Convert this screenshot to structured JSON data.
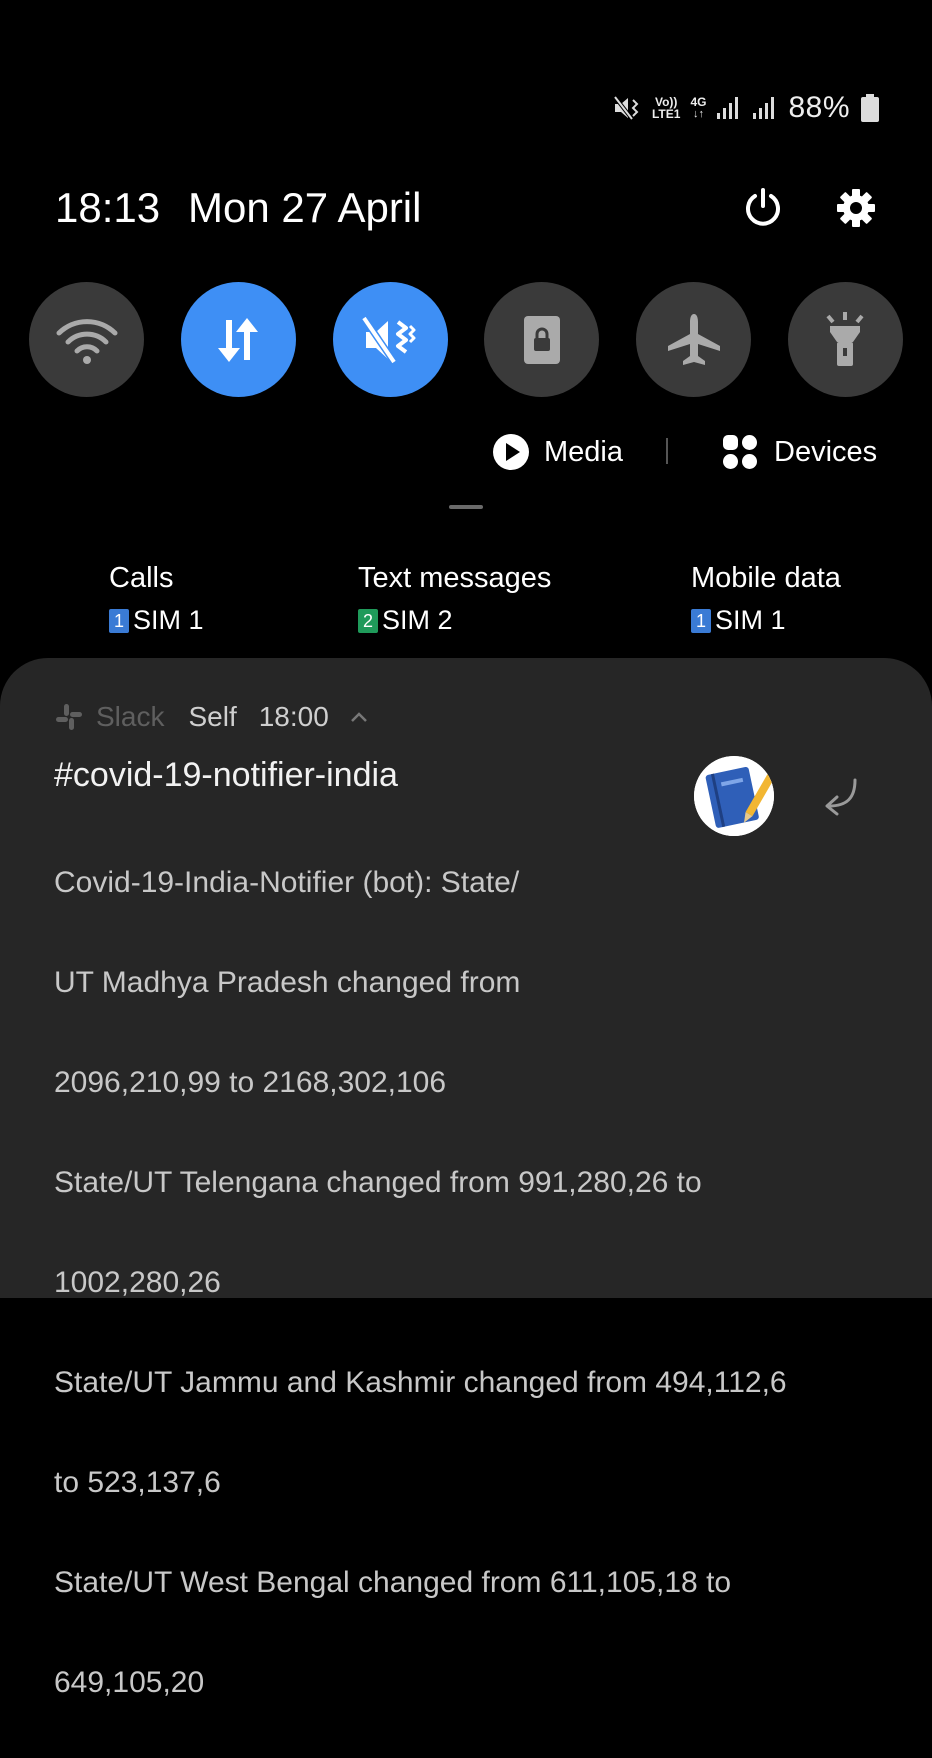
{
  "status_bar": {
    "volte_top": "Vo))",
    "volte_bottom": "LTE1",
    "network_top": "4G",
    "battery": "88%"
  },
  "header": {
    "time": "18:13",
    "date": "Mon 27 April"
  },
  "quick_tiles": [
    {
      "name": "wifi",
      "active": false
    },
    {
      "name": "mobile-data",
      "active": true
    },
    {
      "name": "sound-mute-vibrate",
      "active": true
    },
    {
      "name": "screen-lock",
      "active": false
    },
    {
      "name": "airplane-mode",
      "active": false
    },
    {
      "name": "flashlight",
      "active": false
    }
  ],
  "media_row": {
    "media_label": "Media",
    "devices_label": "Devices"
  },
  "sim": {
    "calls": {
      "label": "Calls",
      "badge": "1",
      "value": "SIM 1",
      "badge_color": "#3a7bd5"
    },
    "texts": {
      "label": "Text messages",
      "badge": "2",
      "value": "SIM 2",
      "badge_color": "#1f9a5a"
    },
    "data": {
      "label": "Mobile data",
      "badge": "1",
      "value": "SIM 1",
      "badge_color": "#3a7bd5"
    }
  },
  "notification": {
    "app": "Slack",
    "sender": "Self",
    "time": "18:00",
    "title": "#covid-19-notifier-india",
    "body_lines": [
      "Covid-19-India-Notifier (bot): State/",
      "UT Madhya Pradesh changed from",
      "2096,210,99 to 2168,302,106",
      "State/UT Telengana changed from 991,280,26 to",
      "1002,280,26",
      "State/UT Jammu and Kashmir changed from 494,112,6",
      "to 523,137,6",
      "State/UT West Bengal changed from 611,105,18 to",
      "649,105,20"
    ]
  },
  "colors": {
    "accent": "#3e8ff5",
    "tile_inactive": "#3a3a3a",
    "card_bg": "#262626"
  }
}
